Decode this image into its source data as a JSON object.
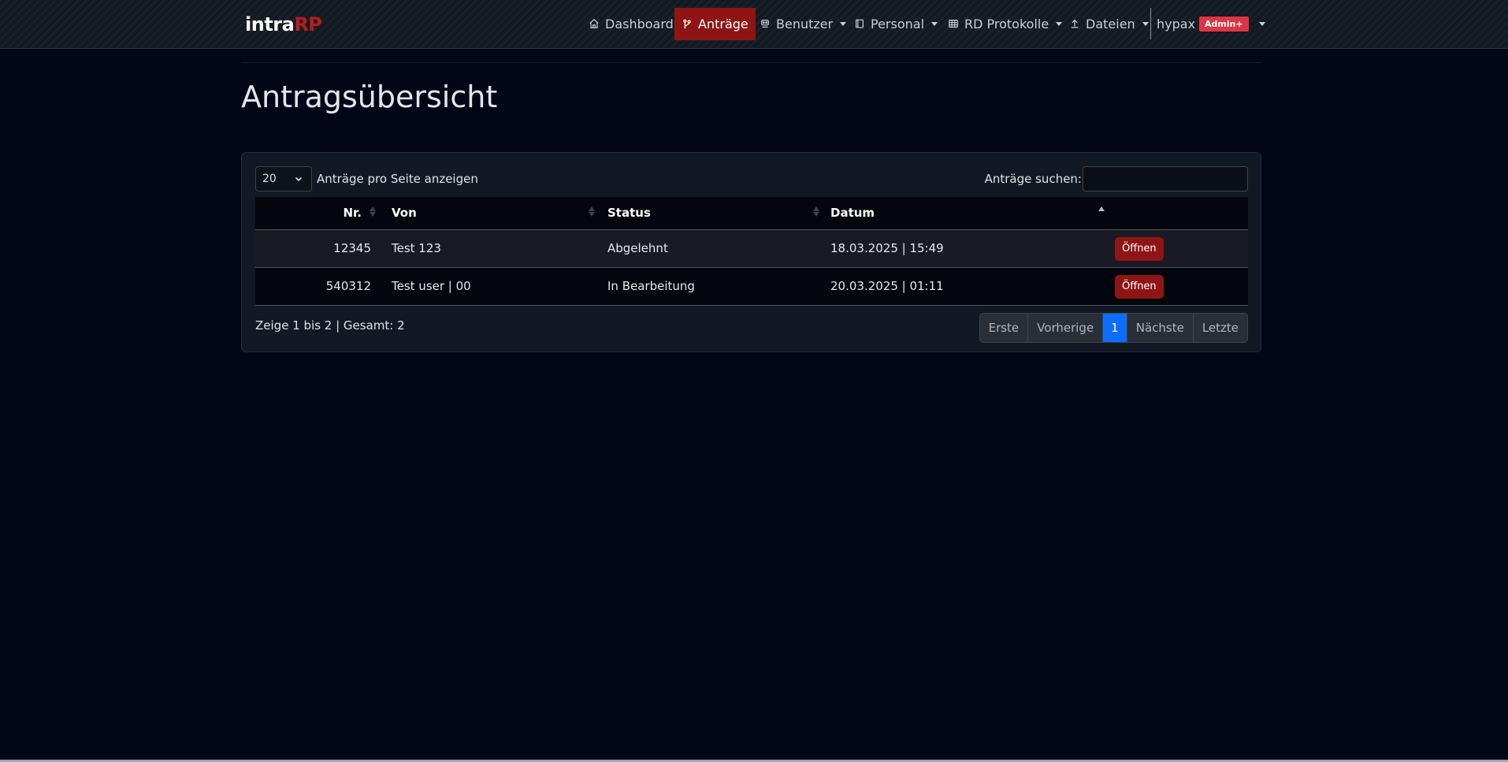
{
  "navbar": {
    "brand_main": "intra",
    "brand_accent": "RP",
    "items": [
      {
        "label": "Dashboard",
        "icon": "home-icon"
      },
      {
        "label": "Anträge",
        "icon": "git-branch-icon",
        "active": true
      },
      {
        "label": "Benutzer",
        "icon": "users-icon",
        "dropdown": true
      },
      {
        "label": "Personal",
        "icon": "book-icon",
        "dropdown": true
      },
      {
        "label": "RD Protokolle",
        "icon": "table-icon",
        "dropdown": true
      },
      {
        "label": "Dateien",
        "icon": "upload-icon",
        "dropdown": true
      }
    ],
    "user": {
      "name": "hypax",
      "badge": "Admin+"
    },
    "colors": {
      "active": "#8f1515",
      "badge": "#dc3545"
    }
  },
  "page": {
    "title": "Antragsübersicht"
  },
  "table_controls": {
    "length_value": "20",
    "length_label": "Anträge pro Seite anzeigen",
    "search_label": "Anträge suchen:",
    "search_value": ""
  },
  "table": {
    "headers": [
      "Nr.",
      "Von",
      "Status",
      "Datum",
      ""
    ],
    "rows": [
      {
        "nr": "12345",
        "von": "Test 123",
        "status": "Abgelehnt",
        "datum": "18.03.2025 | 15:49",
        "action": "Öffnen"
      },
      {
        "nr": "540312",
        "von": "Test user | 00",
        "status": "In Bearbeitung",
        "datum": "20.03.2025 | 01:11",
        "action": "Öffnen"
      }
    ]
  },
  "footer": {
    "info": "Zeige 1 bis 2 | Gesamt: 2",
    "pagination": [
      "Erste",
      "Vorherige",
      "1",
      "Nächste",
      "Letzte"
    ],
    "current_page": "1"
  }
}
